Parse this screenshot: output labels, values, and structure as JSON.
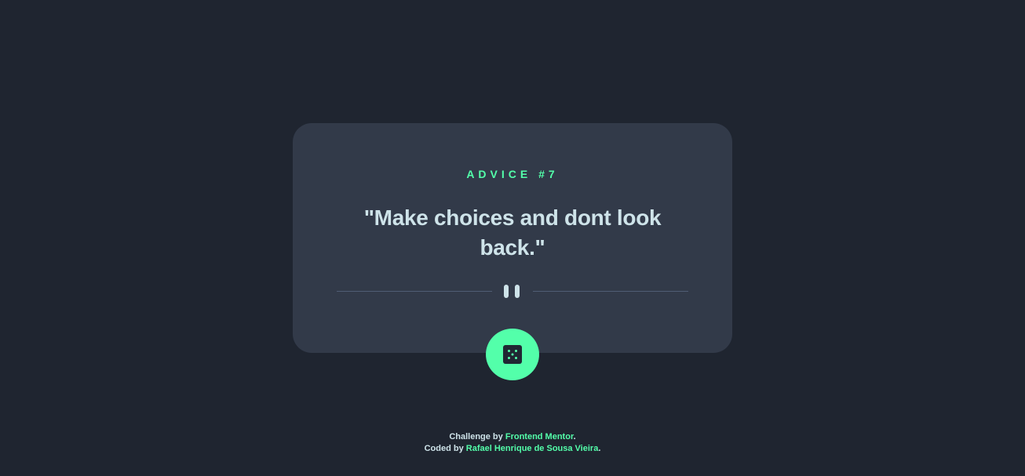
{
  "card": {
    "advice_label": "ADVICE",
    "advice_number": "#7",
    "quote": "\"Make choices and dont look back.\""
  },
  "dice_button": {
    "icon": "dice-icon"
  },
  "divider": {
    "icon": "pause-icon"
  },
  "footer": {
    "line1_prefix": "Challenge by ",
    "line1_link": "Frontend Mentor",
    "line1_suffix": ".",
    "line2_prefix": "Coded by ",
    "line2_link": "Rafael Henrique de Sousa Vieira",
    "line2_suffix": "."
  },
  "colors": {
    "background": "#1f2530",
    "card": "#323a49",
    "accent": "#53ffaa",
    "text": "#cee3e9",
    "divider": "#4f5d74"
  }
}
